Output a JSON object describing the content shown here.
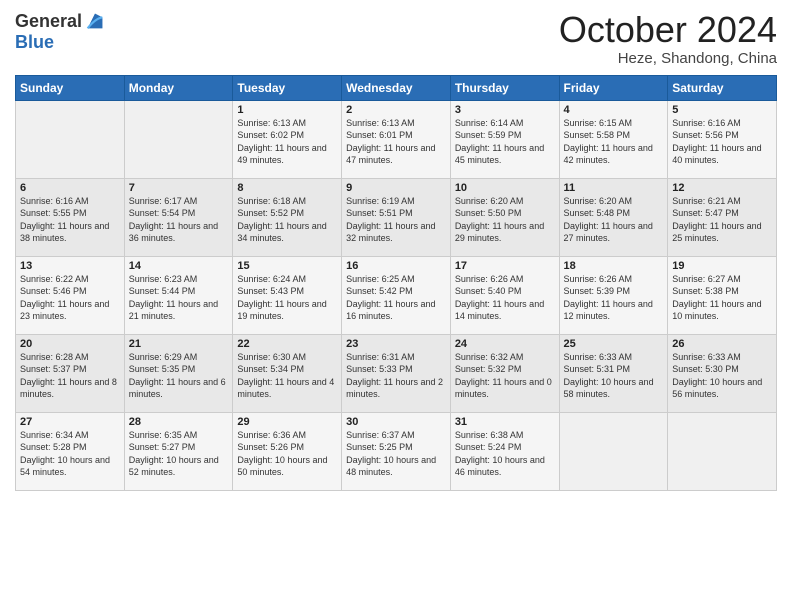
{
  "logo": {
    "line1": "General",
    "line2": "Blue"
  },
  "title": "October 2024",
  "location": "Heze, Shandong, China",
  "days_of_week": [
    "Sunday",
    "Monday",
    "Tuesday",
    "Wednesday",
    "Thursday",
    "Friday",
    "Saturday"
  ],
  "weeks": [
    [
      {
        "day": "",
        "info": ""
      },
      {
        "day": "",
        "info": ""
      },
      {
        "day": "1",
        "info": "Sunrise: 6:13 AM\nSunset: 6:02 PM\nDaylight: 11 hours and 49 minutes."
      },
      {
        "day": "2",
        "info": "Sunrise: 6:13 AM\nSunset: 6:01 PM\nDaylight: 11 hours and 47 minutes."
      },
      {
        "day": "3",
        "info": "Sunrise: 6:14 AM\nSunset: 5:59 PM\nDaylight: 11 hours and 45 minutes."
      },
      {
        "day": "4",
        "info": "Sunrise: 6:15 AM\nSunset: 5:58 PM\nDaylight: 11 hours and 42 minutes."
      },
      {
        "day": "5",
        "info": "Sunrise: 6:16 AM\nSunset: 5:56 PM\nDaylight: 11 hours and 40 minutes."
      }
    ],
    [
      {
        "day": "6",
        "info": "Sunrise: 6:16 AM\nSunset: 5:55 PM\nDaylight: 11 hours and 38 minutes."
      },
      {
        "day": "7",
        "info": "Sunrise: 6:17 AM\nSunset: 5:54 PM\nDaylight: 11 hours and 36 minutes."
      },
      {
        "day": "8",
        "info": "Sunrise: 6:18 AM\nSunset: 5:52 PM\nDaylight: 11 hours and 34 minutes."
      },
      {
        "day": "9",
        "info": "Sunrise: 6:19 AM\nSunset: 5:51 PM\nDaylight: 11 hours and 32 minutes."
      },
      {
        "day": "10",
        "info": "Sunrise: 6:20 AM\nSunset: 5:50 PM\nDaylight: 11 hours and 29 minutes."
      },
      {
        "day": "11",
        "info": "Sunrise: 6:20 AM\nSunset: 5:48 PM\nDaylight: 11 hours and 27 minutes."
      },
      {
        "day": "12",
        "info": "Sunrise: 6:21 AM\nSunset: 5:47 PM\nDaylight: 11 hours and 25 minutes."
      }
    ],
    [
      {
        "day": "13",
        "info": "Sunrise: 6:22 AM\nSunset: 5:46 PM\nDaylight: 11 hours and 23 minutes."
      },
      {
        "day": "14",
        "info": "Sunrise: 6:23 AM\nSunset: 5:44 PM\nDaylight: 11 hours and 21 minutes."
      },
      {
        "day": "15",
        "info": "Sunrise: 6:24 AM\nSunset: 5:43 PM\nDaylight: 11 hours and 19 minutes."
      },
      {
        "day": "16",
        "info": "Sunrise: 6:25 AM\nSunset: 5:42 PM\nDaylight: 11 hours and 16 minutes."
      },
      {
        "day": "17",
        "info": "Sunrise: 6:26 AM\nSunset: 5:40 PM\nDaylight: 11 hours and 14 minutes."
      },
      {
        "day": "18",
        "info": "Sunrise: 6:26 AM\nSunset: 5:39 PM\nDaylight: 11 hours and 12 minutes."
      },
      {
        "day": "19",
        "info": "Sunrise: 6:27 AM\nSunset: 5:38 PM\nDaylight: 11 hours and 10 minutes."
      }
    ],
    [
      {
        "day": "20",
        "info": "Sunrise: 6:28 AM\nSunset: 5:37 PM\nDaylight: 11 hours and 8 minutes."
      },
      {
        "day": "21",
        "info": "Sunrise: 6:29 AM\nSunset: 5:35 PM\nDaylight: 11 hours and 6 minutes."
      },
      {
        "day": "22",
        "info": "Sunrise: 6:30 AM\nSunset: 5:34 PM\nDaylight: 11 hours and 4 minutes."
      },
      {
        "day": "23",
        "info": "Sunrise: 6:31 AM\nSunset: 5:33 PM\nDaylight: 11 hours and 2 minutes."
      },
      {
        "day": "24",
        "info": "Sunrise: 6:32 AM\nSunset: 5:32 PM\nDaylight: 11 hours and 0 minutes."
      },
      {
        "day": "25",
        "info": "Sunrise: 6:33 AM\nSunset: 5:31 PM\nDaylight: 10 hours and 58 minutes."
      },
      {
        "day": "26",
        "info": "Sunrise: 6:33 AM\nSunset: 5:30 PM\nDaylight: 10 hours and 56 minutes."
      }
    ],
    [
      {
        "day": "27",
        "info": "Sunrise: 6:34 AM\nSunset: 5:28 PM\nDaylight: 10 hours and 54 minutes."
      },
      {
        "day": "28",
        "info": "Sunrise: 6:35 AM\nSunset: 5:27 PM\nDaylight: 10 hours and 52 minutes."
      },
      {
        "day": "29",
        "info": "Sunrise: 6:36 AM\nSunset: 5:26 PM\nDaylight: 10 hours and 50 minutes."
      },
      {
        "day": "30",
        "info": "Sunrise: 6:37 AM\nSunset: 5:25 PM\nDaylight: 10 hours and 48 minutes."
      },
      {
        "day": "31",
        "info": "Sunrise: 6:38 AM\nSunset: 5:24 PM\nDaylight: 10 hours and 46 minutes."
      },
      {
        "day": "",
        "info": ""
      },
      {
        "day": "",
        "info": ""
      }
    ]
  ]
}
